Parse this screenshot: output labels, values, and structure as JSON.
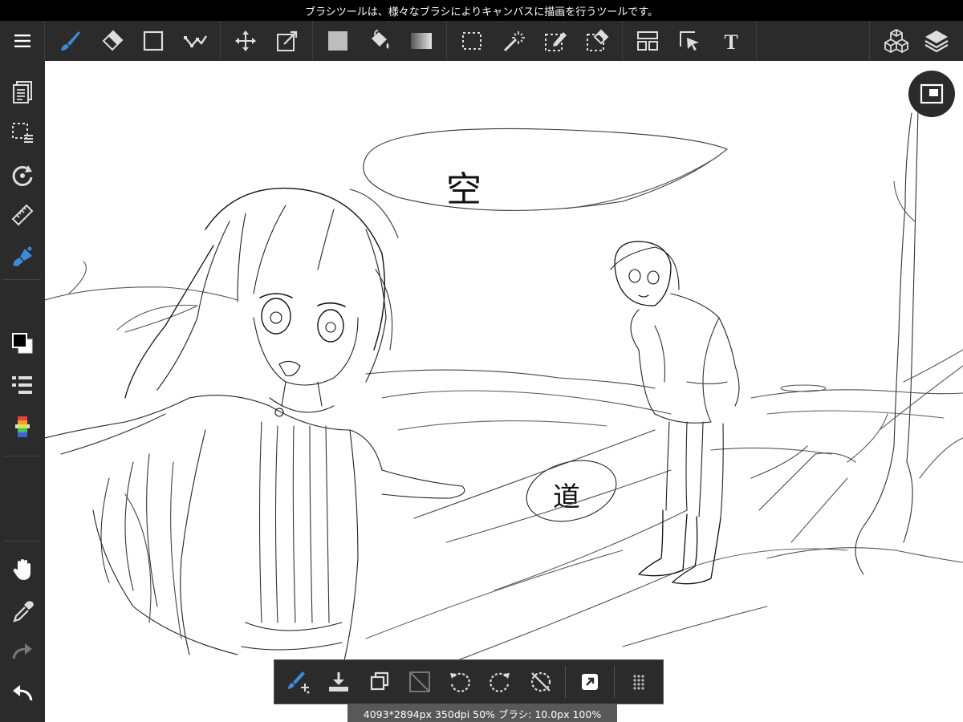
{
  "hint": "ブラシツールは、様々なブラシによりキャンバスに描画を行うツールです。",
  "status": "4093*2894px 350dpi 50% ブラシ: 10.0px 100%",
  "canvas_text": {
    "sky": "空",
    "road": "道"
  },
  "toolbar": {
    "menu": "menu-icon",
    "groups": [
      [
        "brush-icon",
        "eraser-icon",
        "shape-icon",
        "polyline-icon"
      ],
      [
        "move-icon",
        "transform-icon"
      ],
      [
        "fill-color-icon",
        "bucket-icon",
        "gradient-icon"
      ],
      [
        "select-rect-icon",
        "magic-wand-icon",
        "select-pen-icon",
        "select-eraser-icon"
      ],
      [
        "frame-divider-icon",
        "object-select-icon",
        "text-icon"
      ]
    ],
    "right": [
      "material-icon",
      "layers-icon"
    ]
  },
  "sidebar": [
    "pages-icon",
    "selection-menu-icon",
    "rotate-reset-icon",
    "ruler-icon",
    "brush-snap-icon",
    "color-swatch-icon",
    "brush-list-icon",
    "color-palette-icon",
    "hand-icon",
    "eyedropper-icon",
    "redo-icon",
    "undo-icon"
  ],
  "quickbar": [
    "quick-brush-icon",
    "save-icon",
    "duplicate-icon",
    "clear-icon",
    "rotate-left-icon",
    "rotate-right-icon",
    "rotate-reset-icon",
    "share-icon",
    "more-icon"
  ],
  "colors": {
    "bar": "#2b2b2b",
    "accent": "#3d8bd6",
    "status": "#585858"
  }
}
